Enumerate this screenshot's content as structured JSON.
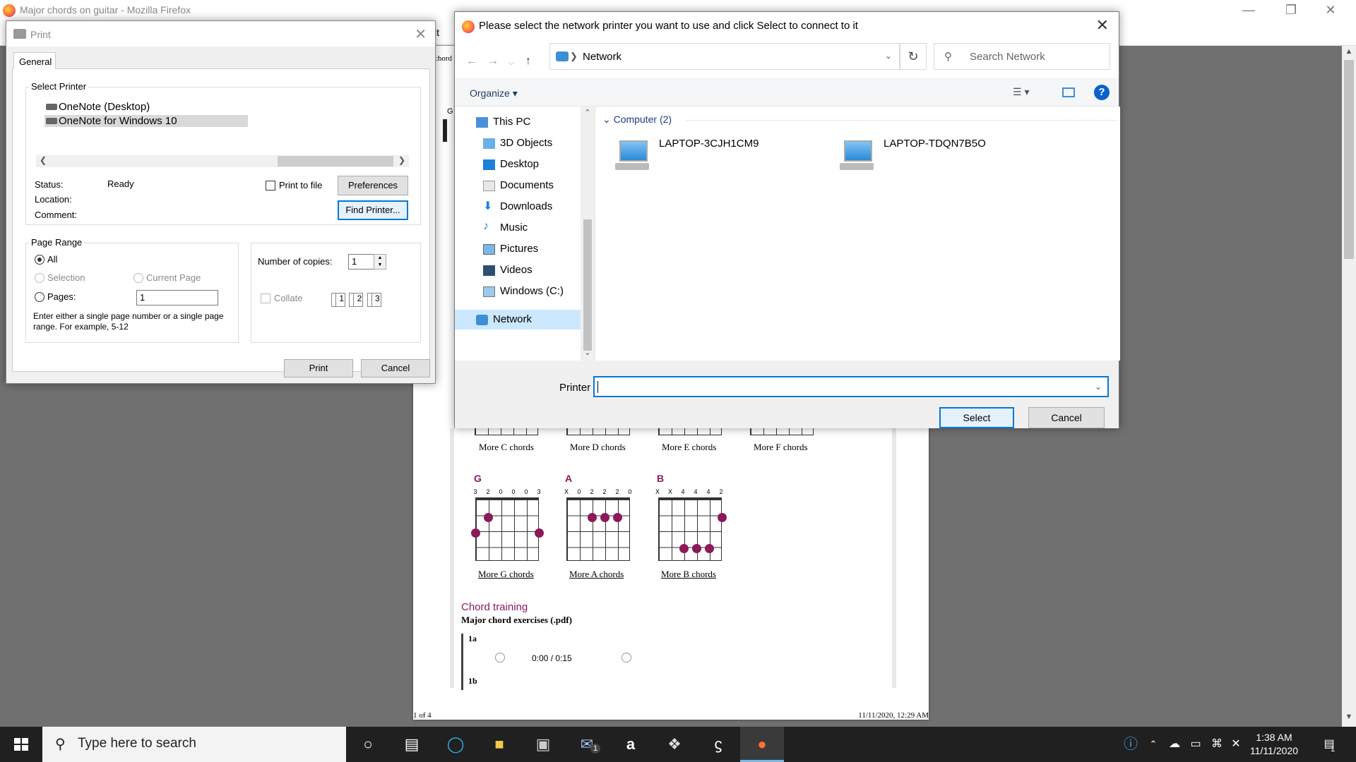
{
  "firefox": {
    "title": "Major chords on guitar - Mozilla Firefox",
    "partial_tab": "it",
    "partial_text": "chord",
    "partial_heading": "G"
  },
  "page": {
    "footer_left": "1 of 4",
    "footer_right": "11/11/2020, 12:29 AM",
    "more_links_row1": [
      "More C chords",
      "More D chords",
      "More E chords",
      "More F chords"
    ],
    "chords": [
      {
        "name": "G",
        "frets": [
          "3",
          "2",
          "0",
          "0",
          "0",
          "3"
        ],
        "link": "More G chords"
      },
      {
        "name": "A",
        "frets": [
          "X",
          "0",
          "2",
          "2",
          "2",
          "0"
        ],
        "link": "More A chords"
      },
      {
        "name": "B",
        "frets": [
          "X",
          "X",
          "4",
          "4",
          "4",
          "2"
        ],
        "link": "More B chords"
      }
    ],
    "training_heading": "Chord training",
    "training_sub": "Major chord exercises (.pdf)",
    "exercise_1a": "1a",
    "exercise_1b": "1b",
    "audio_time": "0:00 / 0:15"
  },
  "print_dialog": {
    "title": "Print",
    "tab": "General",
    "select_printer_label": "Select Printer",
    "printers": [
      "OneNote (Desktop)",
      "OneNote for Windows 10"
    ],
    "selected_printer_index": 1,
    "status_label": "Status:",
    "status_value": "Ready",
    "location_label": "Location:",
    "comment_label": "Comment:",
    "print_to_file": "Print to file",
    "preferences": "Preferences",
    "find_printer": "Find Printer...",
    "page_range_label": "Page Range",
    "all": "All",
    "selection": "Selection",
    "current_page": "Current Page",
    "pages": "Pages:",
    "pages_value": "1",
    "help_text": "Enter either a single page number or a single page range.  For example, 5-12",
    "copies_label": "Number of copies:",
    "copies_value": "1",
    "collate": "Collate",
    "collate_pages": [
      "1",
      "1",
      "2",
      "2",
      "3",
      "3"
    ],
    "print_button": "Print",
    "cancel_button": "Cancel"
  },
  "network_dialog": {
    "title": "Please select the network printer you want to use and click Select to connect to it",
    "path": "Network",
    "search_placeholder": "Search Network",
    "organize": "Organize",
    "nav_items": [
      "This PC",
      "3D Objects",
      "Desktop",
      "Documents",
      "Downloads",
      "Music",
      "Pictures",
      "Videos",
      "Windows (C:)",
      "Network"
    ],
    "group_header": "Computer (2)",
    "computers": [
      "LAPTOP-3CJH1CM9",
      "LAPTOP-TDQN7B5O"
    ],
    "printer_label": "Printer",
    "printer_value": "",
    "select_button": "Select",
    "cancel_button": "Cancel"
  },
  "taskbar": {
    "search_placeholder": "Type here to search",
    "mail_badge": "1",
    "time": "1:38 AM",
    "date": "11/11/2020",
    "notification_badge": "1"
  }
}
